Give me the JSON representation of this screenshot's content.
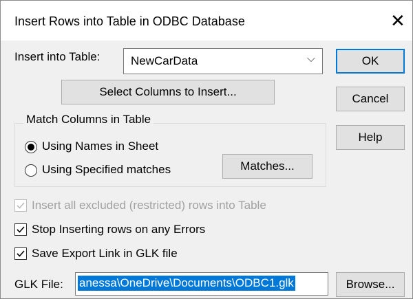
{
  "window": {
    "title": "Insert Rows into Table in ODBC Database",
    "close_glyph": "✕"
  },
  "table_select": {
    "label": "Insert into Table:",
    "value": "NewCarData",
    "arrow": "⌵"
  },
  "buttons": {
    "ok": "OK",
    "cancel": "Cancel",
    "help": "Help",
    "select_columns": "Select Columns to Insert...",
    "matches": "Matches...",
    "browse": "Browse..."
  },
  "match_group": {
    "title": "Match Columns in Table",
    "using_names": "Using Names in Sheet",
    "using_specified": "Using Specified matches",
    "selected": "using_names"
  },
  "options": {
    "insert_excluded": {
      "label": "Insert all excluded (restricted) rows into Table",
      "checked": true,
      "enabled": false
    },
    "stop_on_errors": {
      "label": "Stop Inserting rows on any Errors",
      "checked": true,
      "enabled": true
    },
    "save_link": {
      "label": "Save Export Link in GLK file",
      "checked": true,
      "enabled": true
    }
  },
  "glk_file": {
    "label": "GLK File:",
    "value": "anessa\\OneDrive\\Documents\\ODBC1.glk"
  },
  "colors": {
    "accent": "#0078d7",
    "disabled": "#a0a0a0"
  }
}
